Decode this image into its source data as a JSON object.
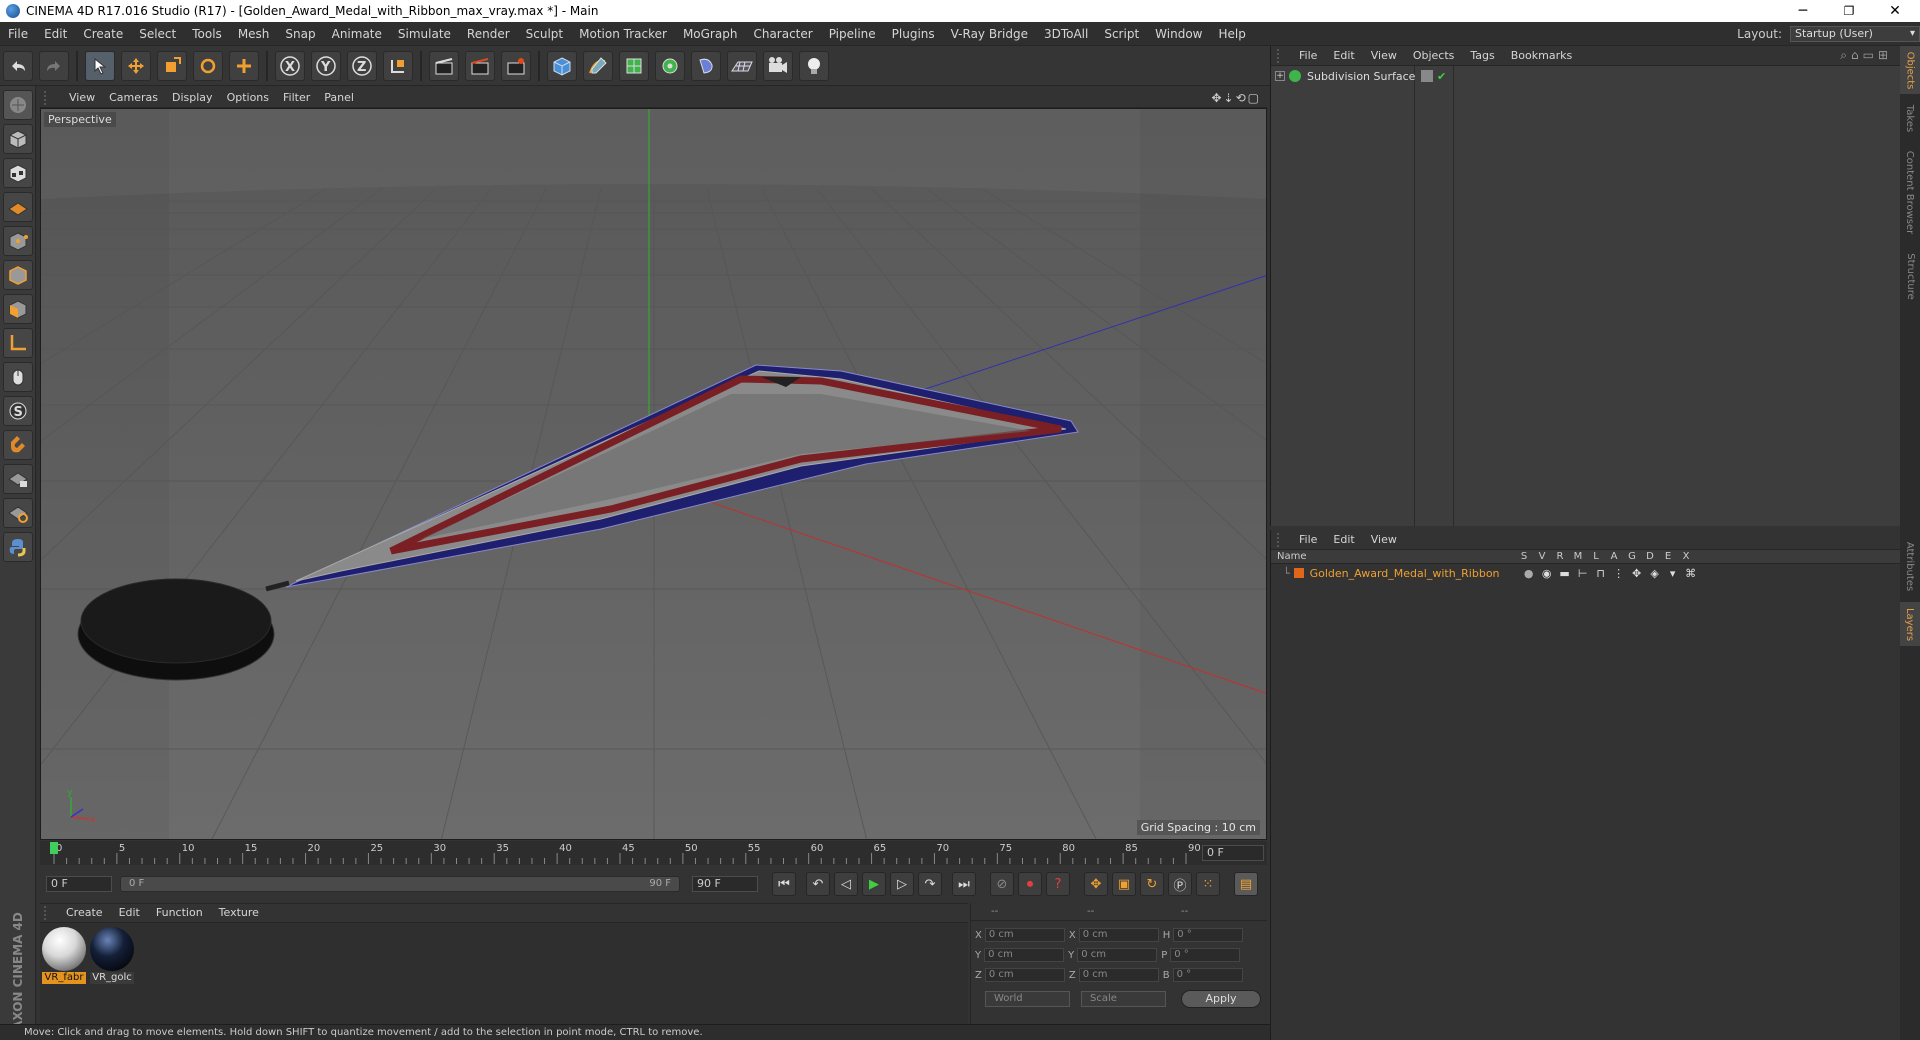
{
  "window": {
    "title": "CINEMA 4D R17.016 Studio (R17) - [Golden_Award_Medal_with_Ribbon_max_vray.max *] - Main",
    "minimize": "─",
    "restore": "❐",
    "close": "✕"
  },
  "menu": {
    "items": [
      "File",
      "Edit",
      "Create",
      "Select",
      "Tools",
      "Mesh",
      "Snap",
      "Animate",
      "Simulate",
      "Render",
      "Sculpt",
      "Motion Tracker",
      "MoGraph",
      "Character",
      "Pipeline",
      "Plugins",
      "V-Ray Bridge",
      "3DToAll",
      "Script",
      "Window",
      "Help"
    ],
    "layout_label": "Layout:",
    "layout_value": "Startup (User)"
  },
  "viewport": {
    "menu": [
      "View",
      "Cameras",
      "Display",
      "Options",
      "Filter",
      "Panel"
    ],
    "camera_label": "Perspective",
    "grid_spacing": "Grid Spacing : 10 cm"
  },
  "timeline": {
    "ticks": [
      "0",
      "5",
      "10",
      "15",
      "20",
      "25",
      "30",
      "35",
      "40",
      "45",
      "50",
      "55",
      "60",
      "65",
      "70",
      "75",
      "80",
      "85",
      "90"
    ],
    "current_frame": "0 F",
    "start_field": "0 F",
    "range_start": "0 F",
    "range_end": "90 F",
    "end_field": "90 F"
  },
  "materials": {
    "menu": [
      "Create",
      "Edit",
      "Function",
      "Texture"
    ],
    "items": [
      {
        "name": "VR_fabr",
        "color": "#e8e8e8"
      },
      {
        "name": "VR_golc",
        "color": "#0d1626"
      }
    ]
  },
  "coords": {
    "header": [
      "--",
      "--",
      "--"
    ],
    "rows": [
      {
        "a": "X",
        "av": "0 cm",
        "b": "X",
        "bv": "0 cm",
        "c": "H",
        "cv": "0 °"
      },
      {
        "a": "Y",
        "av": "0 cm",
        "b": "Y",
        "bv": "0 cm",
        "c": "P",
        "cv": "0 °"
      },
      {
        "a": "Z",
        "av": "0 cm",
        "b": "Z",
        "bv": "0 cm",
        "c": "B",
        "cv": "0 °"
      }
    ],
    "mode": "World",
    "transform": "Scale",
    "apply": "Apply"
  },
  "status": "Move: Click and drag to move elements. Hold down SHIFT to quantize movement / add to the selection in point mode, CTRL to remove.",
  "brand": "MAXON CINEMA 4D",
  "objects": {
    "menu": [
      "File",
      "Edit",
      "View",
      "Objects",
      "Tags",
      "Bookmarks"
    ],
    "items": [
      {
        "name": "Subdivision Surface"
      }
    ]
  },
  "layers": {
    "menu": [
      "File",
      "Edit",
      "View"
    ],
    "header": [
      "Name",
      "S",
      "V",
      "R",
      "M",
      "L",
      "A",
      "G",
      "D",
      "E",
      "X"
    ],
    "items": [
      {
        "name": "Golden_Award_Medal_with_Ribbon",
        "color": "#e0671a"
      }
    ]
  },
  "side_tabs": [
    "Objects",
    "Takes",
    "Content Browser",
    "Structure",
    "Attributes",
    "Layers"
  ]
}
